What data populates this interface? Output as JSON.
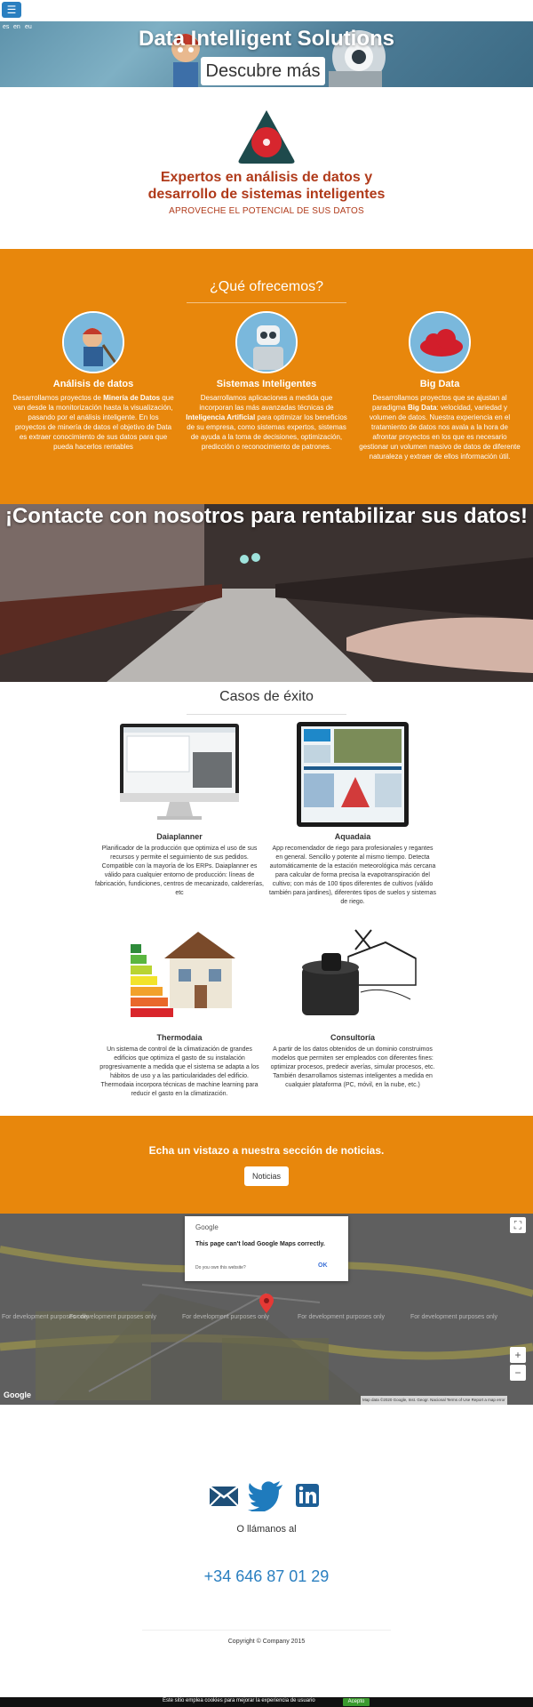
{
  "hero": {
    "menu_icon": "hamburger-icon",
    "languages": [
      "es",
      "en",
      "eu"
    ],
    "title": "Data Intelligent Solutions",
    "cta_label": "Descubre más"
  },
  "intro": {
    "heading_line1": "Expertos en análisis de datos y",
    "heading_line2": "desarrollo de sistemas inteligentes",
    "subtitle": "APROVECHE EL POTENCIAL DE SUS DATOS"
  },
  "offer": {
    "heading": "¿Qué ofrecemos?",
    "items": [
      {
        "title": "Análisis de datos",
        "text_parts": [
          "Desarrollamos proyectos de ",
          "Minería de Datos",
          " que van desde la monitorización hasta la visualización, pasando por el análisis inteligente. En los proyectos de minería de datos el objetivo de Data es extraer conocimiento de sus datos para que pueda hacerlos rentables"
        ]
      },
      {
        "title": "Sistemas Inteligentes",
        "text_parts": [
          "Desarrollamos aplicaciones a medida que incorporan las más avanzadas técnicas de ",
          "Inteligencia Artificial",
          " para optimizar los beneficios de su empresa, como sistemas expertos, sistemas de ayuda a la toma de decisiones, optimización, predicción o reconocimiento de patrones."
        ]
      },
      {
        "title": "Big Data",
        "text_parts": [
          "Desarrollamos proyectos que se ajustan al paradigma ",
          "Big Data",
          ": velocidad, variedad y volumen de datos. Nuestra experiencia en el tratamiento de datos nos avala a la hora de afrontar proyectos en los que es necesario gestionar un volumen masivo de datos de diferente naturaleza y extraer de ellos información útil."
        ]
      }
    ]
  },
  "banner": {
    "title": "¡Contacte con nosotros para rentabilizar sus datos!"
  },
  "cases": {
    "heading": "Casos de éxito",
    "items": [
      {
        "title": "Daiaplanner",
        "text": "Planificador de la producción que optimiza el uso de sus recursos y permite el seguimiento de sus pedidos. Compatible con la mayoría de los ERPs. Daiaplanner es válido para cualquier entorno de producción: líneas de fabricación, fundiciones, centros de mecanizado, caldererías, etc"
      },
      {
        "title": "Aquadaia",
        "text": "App recomendador de riego para profesionales y regantes en general. Sencillo y potente al mismo tiempo. Detecta automáticamente de la estación meteorológica más cercana para calcular de forma precisa la evapotranspiración del cultivo; con más de 100 tipos diferentes de cultivos (válido también para jardines), diferentes tipos de suelos y sistemas de riego."
      },
      {
        "title": "Thermodaia",
        "text": "Un sistema de control de la climatización de grandes edificios que optimiza el gasto de su instalación progresivamente a medida que el sistema se adapta a los hábitos de uso y a las particularidades del edificio. Thermodaia incorpora técnicas de machine learning para reducir el gasto en la climatización."
      },
      {
        "title": "Consultoría",
        "text": "A partir de los datos obtenidos de un dominio construimos modelos que permiten ser empleados con diferentes fines: optimizar procesos, predecir averías, simular procesos, etc. También desarrollamos sistemas inteligentes a medida en cualquier plataforma (PC, móvil, en la nube, etc.)"
      }
    ]
  },
  "news": {
    "heading": "Echa un vistazo a nuestra sección de noticias.",
    "button_label": "Noticias"
  },
  "map": {
    "dialog_brand": "Google",
    "dialog_title": "This page can't load Google Maps correctly.",
    "dialog_question": "Do you own this website?",
    "dialog_ok": "OK",
    "watermark": "For development purposes only",
    "zoom_in": "+",
    "zoom_out": "−",
    "footer_brand": "Google",
    "attribution": "Map data ©2020 Google, Inst. Geogr. Nacional",
    "terms": "Terms of Use",
    "report": "Report a map error"
  },
  "contact": {
    "icons": [
      "mail-icon",
      "twitter-icon",
      "linkedin-icon"
    ],
    "call_heading": "O llámanos al",
    "phone": "+34 646 87 01 29",
    "copyright": "Copyright © Company 2015"
  },
  "cookie": {
    "text": "Este sitio emplea cookies para mejorar la experiencia de usuario",
    "accept_label": "Acepto"
  },
  "colors": {
    "orange": "#e8870c",
    "accent_red": "#b03a1a",
    "link_blue": "#2a7fc0"
  }
}
